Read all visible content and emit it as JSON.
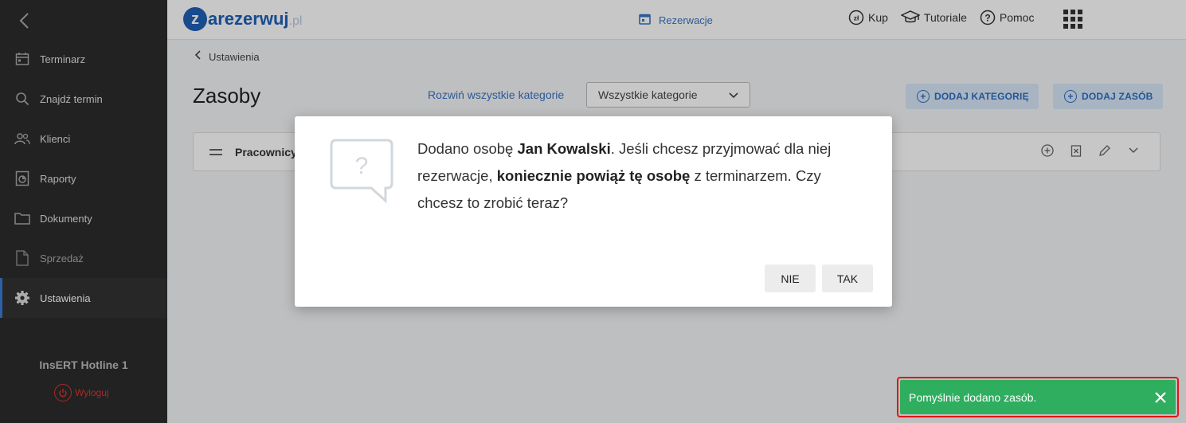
{
  "sidebar": {
    "items": [
      {
        "label": "Terminarz",
        "icon": "calendar-icon"
      },
      {
        "label": "Znajdź termin",
        "icon": "search-icon"
      },
      {
        "label": "Klienci",
        "icon": "users-icon"
      },
      {
        "label": "Raporty",
        "icon": "report-icon"
      },
      {
        "label": "Dokumenty",
        "icon": "folder-icon"
      },
      {
        "label": "Sprzedaż",
        "icon": "document-icon"
      },
      {
        "label": "Ustawienia",
        "icon": "gear-icon",
        "active": true
      }
    ],
    "user_name": "InsERT Hotline 1",
    "logout_label": "Wyloguj"
  },
  "header": {
    "logo_text": "arezerwuj",
    "logo_letter": "z",
    "logo_suffix": ".pl",
    "center_nav_label": "Rezerwacje",
    "right_nav": [
      {
        "label": "Kup",
        "icon": "currency-icon"
      },
      {
        "label": "Tutoriale",
        "icon": "graduation-cap-icon"
      },
      {
        "label": "Pomoc",
        "icon": "help-icon"
      }
    ]
  },
  "page": {
    "breadcrumb": "Ustawienia",
    "title": "Zasoby",
    "expand_all_label": "Rozwiń wszystkie kategorie",
    "category_filter_value": "Wszystkie kategorie",
    "add_category_label": "DODAJ KATEGORIĘ",
    "add_resource_label": "DODAJ ZASÓB",
    "category_name": "Pracownicy"
  },
  "dialog": {
    "text_1": "Dodano osobę ",
    "text_2": "Jan Kowalski",
    "text_3": ". Jeśli chcesz przyjmować dla niej rezerwacje, ",
    "text_4": "koniecznie powiąż tę osobę",
    "text_5": " z terminarzem. Czy chcesz to zrobić teraz?",
    "no_label": "NIE",
    "yes_label": "TAK"
  },
  "toast": {
    "message": "Pomyślnie dodano zasób.",
    "color": "#2fae5f",
    "border_color": "#e01616"
  },
  "colors": {
    "accent": "#3a73c4",
    "sidebar_bg": "#2c2c2c",
    "danger": "#dd3333"
  }
}
